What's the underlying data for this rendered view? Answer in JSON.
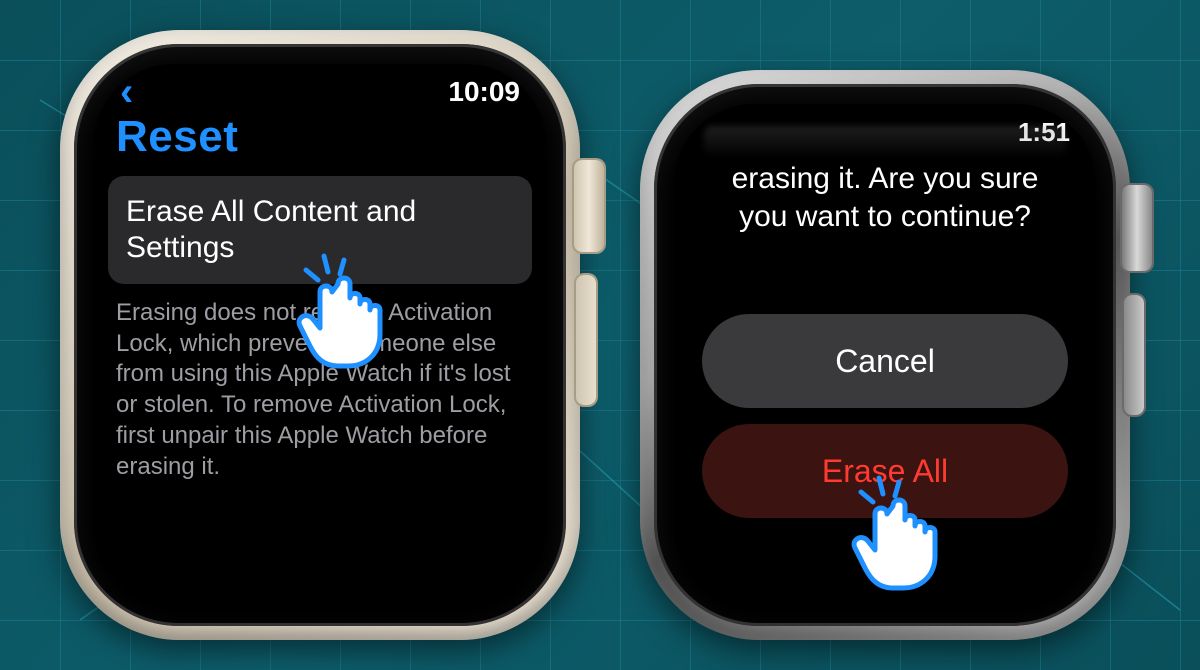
{
  "left_watch": {
    "status": {
      "time": "10:09"
    },
    "title": "Reset",
    "menu_item": "Erase All Content and Settings",
    "description": "Erasing does not remove Activation Lock, which prevents someone else from using this Apple Watch if it's lost or stolen. To remove Activation Lock, first unpair this Apple Watch before erasing it."
  },
  "right_watch": {
    "status": {
      "time": "1:51"
    },
    "dialog": {
      "message": "erasing it. Are you sure you want to continue?",
      "cancel": "Cancel",
      "confirm": "Erase All"
    }
  },
  "colors": {
    "link_blue": "#1e90ff",
    "destructive_red": "#ff3b30"
  }
}
